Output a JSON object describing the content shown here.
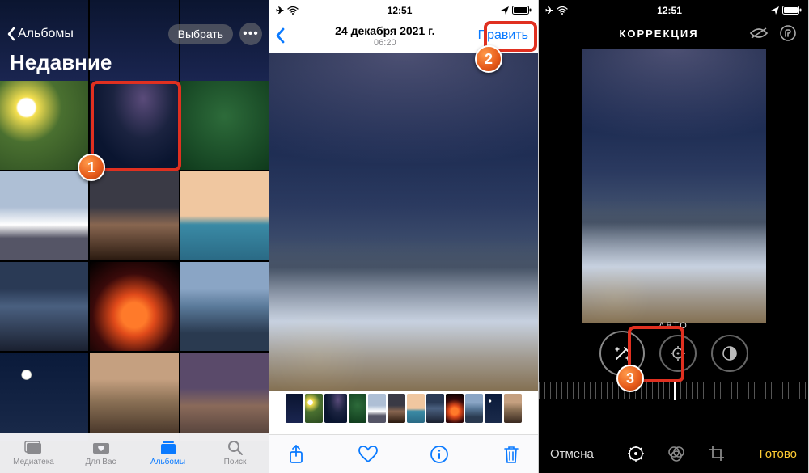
{
  "status": {
    "time": "12:51"
  },
  "phone1": {
    "back_label": "Альбомы",
    "select_label": "Выбрать",
    "title": "Недавние",
    "tabs": {
      "library": "Медиатека",
      "foryou": "Для Вас",
      "albums": "Альбомы",
      "search": "Поиск"
    }
  },
  "phone2": {
    "date": "24 декабря 2021 г.",
    "time": "06:20",
    "edit_label": "Править"
  },
  "phone3": {
    "header_title": "КОРРЕКЦИЯ",
    "auto_label": "АВТО",
    "cancel_label": "Отмена",
    "done_label": "Готово"
  },
  "markers": {
    "one": "1",
    "two": "2",
    "three": "3"
  }
}
